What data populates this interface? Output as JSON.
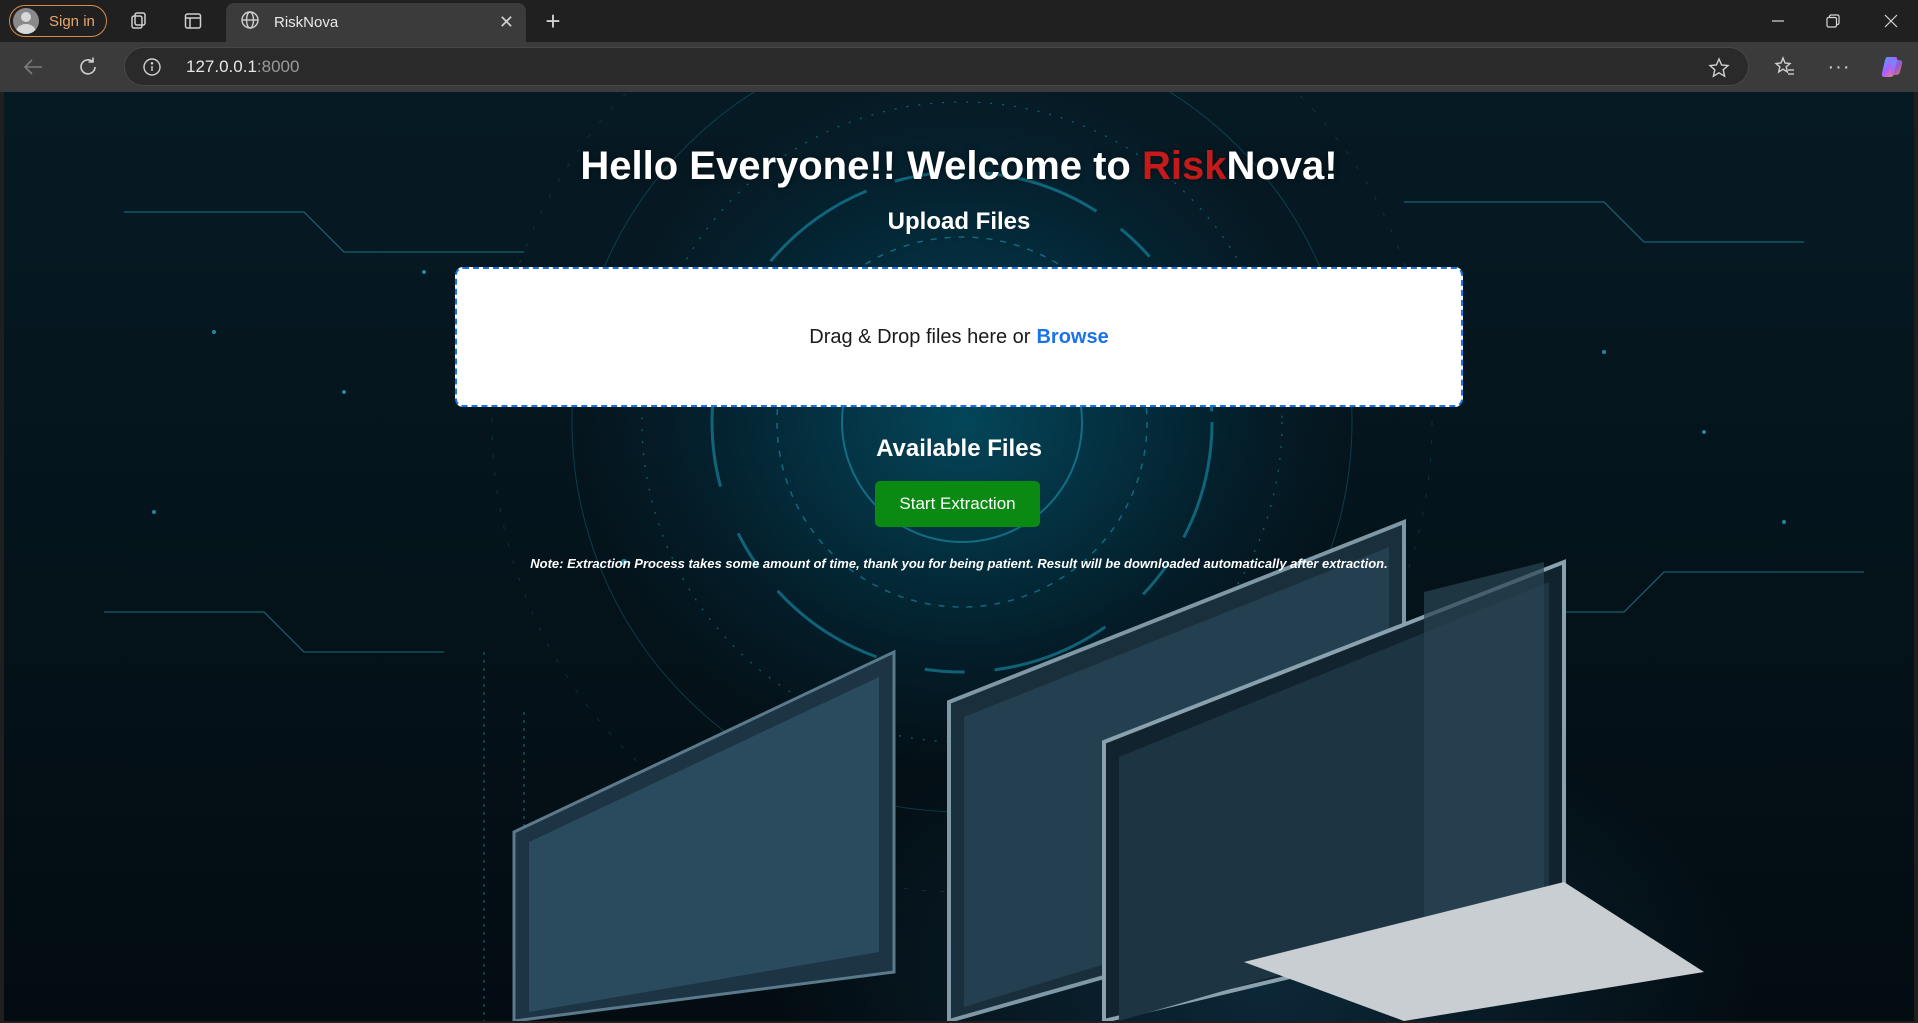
{
  "browser": {
    "profile_label": "Sign in",
    "tab_title": "RiskNova",
    "url_host": "127.0.0.1",
    "url_port": ":8000",
    "icons": [
      "workspaces-icon",
      "tab-actions-icon",
      "globe-icon",
      "close-icon",
      "new-tab-icon",
      "back-icon",
      "refresh-icon",
      "site-info-icon",
      "favorite-star-icon",
      "favorites-icon",
      "more-icon",
      "copilot-icon",
      "minimize-icon",
      "restore-icon",
      "window-close-icon"
    ]
  },
  "page": {
    "headline_prefix": "Hello Everyone!! Welcome to ",
    "headline_accent": "Risk",
    "headline_suffix": "Nova!",
    "upload_title": "Upload Files",
    "dropzone_text": "Drag & Drop files here or",
    "browse_label": "Browse",
    "available_title": "Available Files",
    "start_button": "Start Extraction",
    "note": "Note: Extraction Process takes some amount of time, thank you for being patient. Result will be downloaded automatically after extraction."
  },
  "colors": {
    "accent_red": "#c41a1a",
    "link_blue": "#1a73e8",
    "button_green": "#0a8a12",
    "profile_orange": "#e9a66a"
  }
}
